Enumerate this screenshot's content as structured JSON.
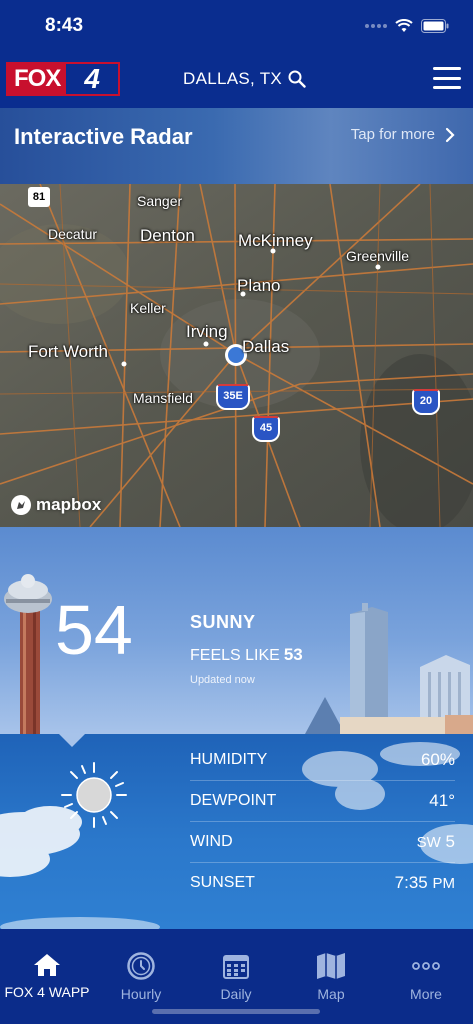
{
  "status": {
    "time": "8:43"
  },
  "header": {
    "logo_fox": "FOX",
    "logo_num": "4",
    "location": "DALLAS, TX"
  },
  "radar": {
    "title": "Interactive Radar",
    "tap": "Tap for more",
    "attribution": "mapbox",
    "cities": [
      "Sanger",
      "Decatur",
      "Denton",
      "McKinney",
      "Greenville",
      "Plano",
      "Keller",
      "Irving",
      "Dallas",
      "Fort Worth",
      "Mansfield"
    ],
    "shields": [
      "81",
      "35E",
      "45",
      "20"
    ]
  },
  "current": {
    "temp": "54",
    "condition": "SUNNY",
    "feels_label": "FEELS LIKE",
    "feels_value": "53",
    "updated": "Updated now"
  },
  "details": [
    {
      "label": "HUMIDITY",
      "value": "60%"
    },
    {
      "label": "DEWPOINT",
      "value": "41°"
    },
    {
      "label": "WIND",
      "dir": "SW",
      "value": "5"
    },
    {
      "label": "SUNSET",
      "value": "7:35",
      "suffix": "PM"
    }
  ],
  "tabs": [
    {
      "label": "FOX 4 WAPP",
      "icon": "home-icon"
    },
    {
      "label": "Hourly",
      "icon": "clock-icon"
    },
    {
      "label": "Daily",
      "icon": "calendar-icon"
    },
    {
      "label": "Map",
      "icon": "map-icon"
    },
    {
      "label": "More",
      "icon": "more-icon"
    }
  ],
  "colors": {
    "brand_blue": "#0a2d8f",
    "fox_red": "#c8102e",
    "tab_inactive": "#9fb4df"
  }
}
